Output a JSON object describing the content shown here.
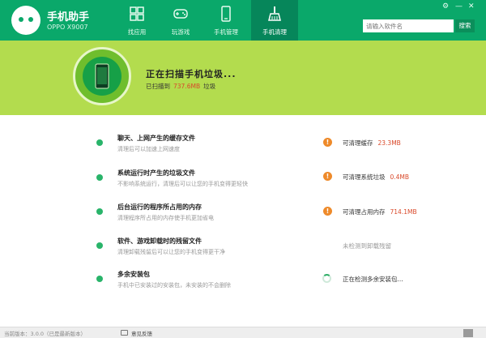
{
  "app": {
    "title": "手机助手",
    "device": "OPPO X9007"
  },
  "window_controls": [
    "⚙",
    "—",
    "✕"
  ],
  "tabs": [
    {
      "label": "找应用",
      "icon": "apps-grid-icon"
    },
    {
      "label": "玩游戏",
      "icon": "gamepad-icon"
    },
    {
      "label": "手机管理",
      "icon": "phone-icon"
    },
    {
      "label": "手机清理",
      "icon": "broom-icon",
      "active": true
    }
  ],
  "search": {
    "placeholder": "请输入软件名",
    "button": "搜索"
  },
  "scan": {
    "title": "正在扫描手机垃圾...",
    "prefix": "已扫描到",
    "size": "737.6MB",
    "suffix": "垃圾"
  },
  "items": [
    {
      "title": "聊天、上网产生的缓存文件",
      "desc": "清理后可以加速上网速度",
      "result_label": "可清理缓存",
      "result_value": "23.3MB",
      "status": "warning"
    },
    {
      "title": "系统运行时产生的垃圾文件",
      "desc": "不影响系统运行，清理后可以让您的手机变得更轻快",
      "result_label": "可清理系统垃圾",
      "result_value": "0.4MB",
      "status": "warning"
    },
    {
      "title": "后台运行的程序所占用的内存",
      "desc": "清理程序所占用的内存使手机更加省电",
      "result_label": "可清理占用内存",
      "result_value": "714.1MB",
      "status": "warning"
    },
    {
      "title": "软件、游戏卸载时的残留文件",
      "desc": "清理卸载残留后可以让您的手机变得更干净",
      "result_label": "未检测到卸载残留",
      "result_value": "",
      "status": "none"
    },
    {
      "title": "多余安装包",
      "desc": "手机中已安装过的安装包，未安装的不会删除",
      "result_label": "正在检测多余安装包...",
      "result_value": "",
      "status": "scanning"
    }
  ],
  "footer": {
    "version": "当前版本：3.0.0（已是最新版本）",
    "feedback": "意见反馈"
  },
  "colors": {
    "header": "#0aa86a",
    "banner": "#b3dc4e",
    "warning": "#ee8a2a",
    "highlight": "#d9492a",
    "dot": "#29b46a"
  }
}
